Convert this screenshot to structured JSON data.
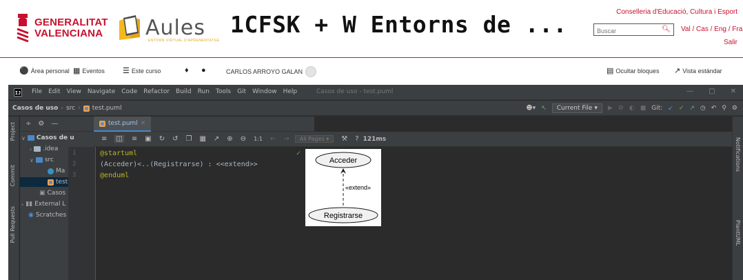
{
  "header": {
    "gva_line1": "GENERALITAT",
    "gva_line2": "VALENCIANA",
    "aules": "Aules",
    "aules_sub": "ENTORN VIRTUAL D'APRENENTATGE",
    "course_title": "1CFSK + W Entorns de ...",
    "department": "Conselleria d'Educació, Cultura i Esport",
    "search_placeholder": "Buscar",
    "languages": "Val / Cas / Eng / Fra",
    "logout": "Salir"
  },
  "navbar": {
    "personal_area": "Área personal",
    "events": "Eventos",
    "this_course": "Este curso",
    "user_name": "CARLOS ARROYO GALAN",
    "hide_blocks": "Ocultar bloques",
    "standard_view": "Vista estándar"
  },
  "ide": {
    "menu": [
      "File",
      "Edit",
      "View",
      "Navigate",
      "Code",
      "Refactor",
      "Build",
      "Run",
      "Tools",
      "Git",
      "Window",
      "Help"
    ],
    "window_title": "Casos de uso - test.puml",
    "breadcrumb": {
      "project": "Casos de uso",
      "folder": "src",
      "file": "test.puml"
    },
    "run_config": "Current File",
    "git_label": "Git:",
    "side_tabs_left": [
      "Project",
      "Commit",
      "Pull Requests"
    ],
    "side_tabs_right": [
      "Notifications",
      "PlantUML"
    ],
    "tree": [
      {
        "label": "Casos de u",
        "type": "folder-blue",
        "arrow": "v",
        "indent": 0
      },
      {
        "label": ".idea",
        "type": "folder",
        "arrow": ">",
        "indent": 1
      },
      {
        "label": "src",
        "type": "folder-blue",
        "arrow": "v",
        "indent": 1
      },
      {
        "label": "Ma",
        "type": "class",
        "arrow": "",
        "indent": 3
      },
      {
        "label": "test",
        "type": "puml",
        "arrow": "",
        "indent": 3,
        "selected": true
      },
      {
        "label": "Casos",
        "type": "file",
        "arrow": "",
        "indent": 2
      },
      {
        "label": "External L",
        "type": "lib",
        "arrow": ">",
        "indent": 0
      },
      {
        "label": "Scratches",
        "type": "scratch",
        "arrow": "",
        "indent": 0
      }
    ],
    "editor_tab": "test.puml",
    "zoom_ratio": "1:1",
    "pages_select": "All Pages",
    "render_time": "121ms",
    "code_lines": [
      {
        "num": "1",
        "text": "@startuml",
        "style": "kw"
      },
      {
        "num": "2",
        "text": "(Acceder)<..(Registrarse) : <<extend>>",
        "style": "txt"
      },
      {
        "num": "3",
        "text": "@enduml",
        "style": "kw"
      }
    ],
    "diagram": {
      "top_usecase": "Acceder",
      "bottom_usecase": "Registrarse",
      "relation": "«extend»"
    }
  }
}
